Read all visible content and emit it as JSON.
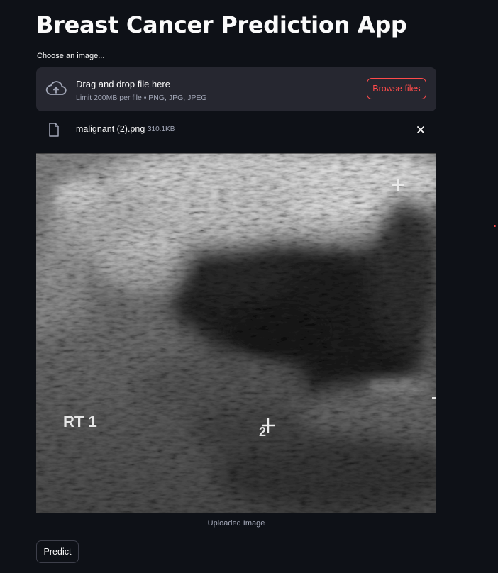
{
  "app": {
    "title": "Breast Cancer Prediction App"
  },
  "uploader": {
    "label": "Choose an image...",
    "dropzone_title": "Drag and drop file here",
    "dropzone_subtitle": "Limit 200MB per file • PNG, JPG, JPEG",
    "browse_label": "Browse files",
    "icon": "cloud-upload-icon"
  },
  "uploaded_file": {
    "name": "malignant (2).png",
    "size": "310.1KB",
    "icon": "file-icon",
    "remove_icon": "close-icon"
  },
  "image": {
    "overlay_label": "RT 1",
    "marker_number": "2",
    "caption": "Uploaded Image"
  },
  "actions": {
    "predict_label": "Predict"
  },
  "colors": {
    "background": "#0e1117",
    "surface": "#262730",
    "accent": "#ff4b4b",
    "text": "#fafafa",
    "muted_text": "#a3a8b8"
  }
}
